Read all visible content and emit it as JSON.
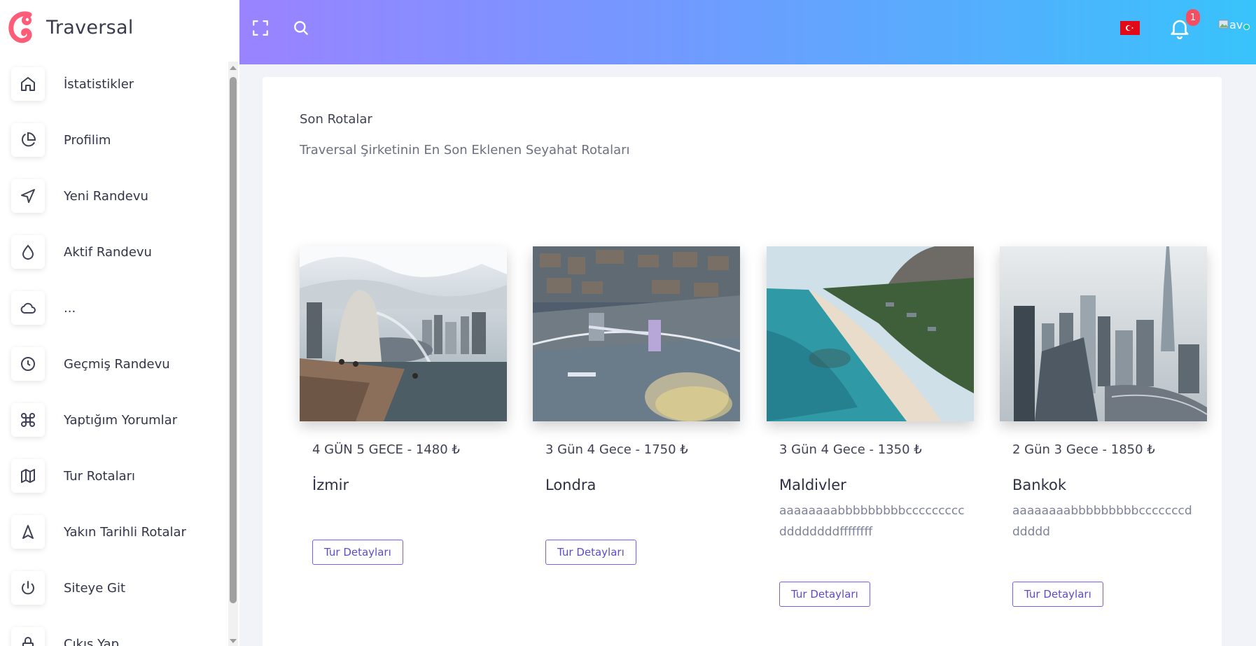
{
  "brand": {
    "name": "Traversal",
    "accent": "#ff5c7a"
  },
  "sidebar": {
    "items": [
      {
        "label": "İstatistikler",
        "icon": "home-icon"
      },
      {
        "label": "Profilim",
        "icon": "pie-chart-icon"
      },
      {
        "label": "Yeni Randevu",
        "icon": "send-arrow-icon"
      },
      {
        "label": "Aktif Randevu",
        "icon": "droplet-icon"
      },
      {
        "label": "...",
        "icon": "cloud-icon"
      },
      {
        "label": "Geçmiş Randevu",
        "icon": "clock-icon"
      },
      {
        "label": "Yaptığım Yorumlar",
        "icon": "command-icon"
      },
      {
        "label": "Tur Rotaları",
        "icon": "map-icon"
      },
      {
        "label": "Yakın Tarihli Rotalar",
        "icon": "navigation-icon"
      },
      {
        "label": "Siteye Git",
        "icon": "power-icon"
      },
      {
        "label": "Çıkış Yap",
        "icon": "lock-icon"
      }
    ]
  },
  "header": {
    "gradient_start": "#9a83ff",
    "gradient_end": "#38c3fb",
    "notification_count": "1",
    "avatar_alt": "av",
    "flag": "turkey-flag-icon"
  },
  "main": {
    "title": "Son Rotalar",
    "subtitle": "Traversal Şirketinin En Son Eklenen Seyahat Rotaları",
    "tours": [
      {
        "meta": "4 GÜN 5 GECE - 1480 ₺",
        "city": "İzmir",
        "desc": "",
        "button": "Tur Detayları",
        "image": "singapore-merlion-photo"
      },
      {
        "meta": "3 Gün 4 Gece - 1750 ₺",
        "city": "Londra",
        "desc": "",
        "button": "Tur Detayları",
        "image": "london-tower-bridge-photo"
      },
      {
        "meta": "3 Gün 4 Gece - 1350 ₺",
        "city": "Maldivler",
        "desc": "aaaaaaaabbbbbbbbbcccccccccddddddddffffffff",
        "button": "Tur Detayları",
        "image": "beach-coast-photo"
      },
      {
        "meta": "2 Gün 3 Gece - 1850 ₺",
        "city": "Bankok",
        "desc": "aaaaaaaabbbbbbbbbcccccccdddddd",
        "button": "Tur Detayları",
        "image": "dubai-skyline-photo"
      }
    ]
  }
}
